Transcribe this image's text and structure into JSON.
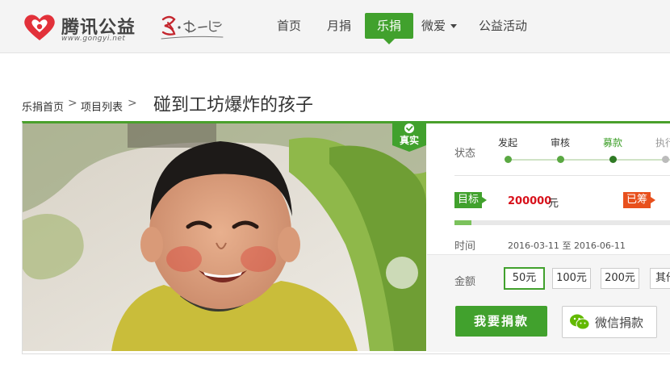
{
  "header": {
    "logo_text": "腾讯公益",
    "logo_url": "www.gongyi.net",
    "slogan": "乐·在一起",
    "nav": [
      {
        "label": "首页"
      },
      {
        "label": "月捐"
      },
      {
        "label": "乐捐"
      },
      {
        "label": "微爱"
      },
      {
        "label": "公益活动"
      }
    ]
  },
  "breadcrumb": {
    "items": [
      "乐捐首页",
      "项目列表"
    ],
    "separator": ">"
  },
  "project": {
    "title": "碰到工坊爆炸的孩子",
    "badge": "真实",
    "status_label": "状态",
    "steps": [
      "发起",
      "审核",
      "募款",
      "执行"
    ],
    "current_step": 2,
    "target_tag": "目标",
    "target_amount": "200000",
    "target_unit": "元",
    "raised_tag": "已筹",
    "progress": 0.08,
    "time_label": "时间",
    "start_date": "2016-03-11",
    "to_word": "至",
    "end_date": "2016-06-11"
  },
  "donate": {
    "amount_label": "金额",
    "amounts": [
      "50元",
      "100元",
      "200元",
      "其他"
    ],
    "selected": 0,
    "donate_button": "我要捐款",
    "wechat_button": "微信捐款"
  },
  "colors": {
    "accent": "#41a12d",
    "target_red": "#d8111b",
    "raised_orange": "#e8501d"
  }
}
